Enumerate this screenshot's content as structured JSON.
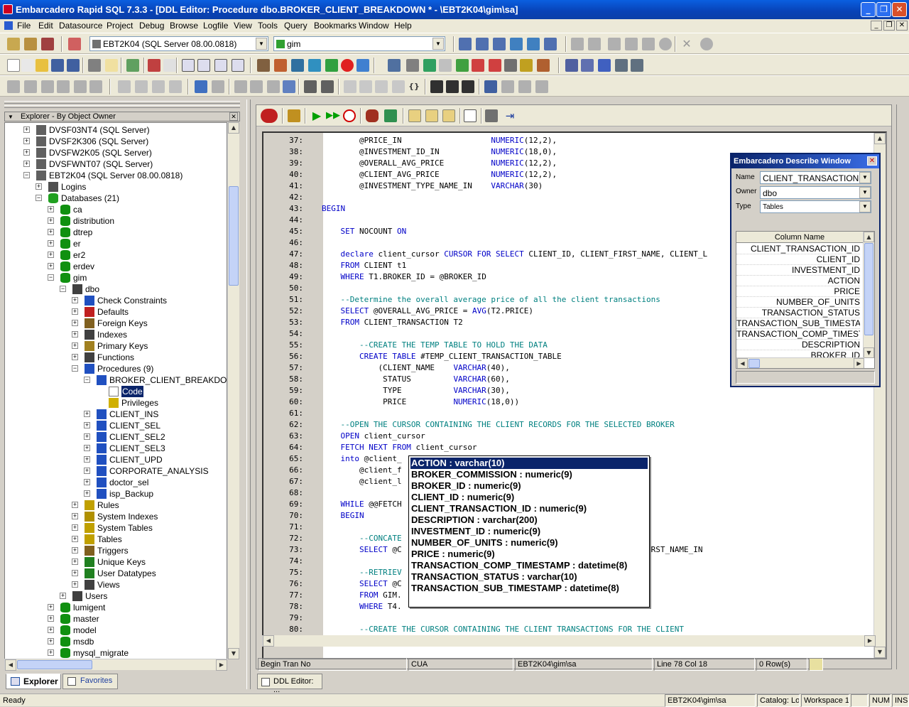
{
  "window": {
    "title": "Embarcadero Rapid SQL 7.3.3 - [DDL Editor: Procedure dbo.BROKER_CLIENT_BREAKDOWN * - \\EBT2K04\\gim\\sa]"
  },
  "menu": [
    "File",
    "Edit",
    "Datasource",
    "Project",
    "Debug",
    "Browse",
    "Logfile",
    "View",
    "Tools",
    "Query",
    "Bookmarks",
    "Window",
    "Help"
  ],
  "toolbar": {
    "datasource_combo": "EBT2K04 (SQL Server 08.00.0818)",
    "database_combo": "gim"
  },
  "explorer": {
    "header": "Explorer - By Object Owner",
    "tree": [
      {
        "label": "DVSF03NT4 (SQL Server)",
        "level": 1,
        "pm": "+",
        "icon": "server-icon"
      },
      {
        "label": "DVSF2K306 (SQL Server)",
        "level": 1,
        "pm": "+",
        "icon": "server-icon"
      },
      {
        "label": "DVSFW2K05 (SQL Server)",
        "level": 1,
        "pm": "+",
        "icon": "server-icon"
      },
      {
        "label": "DVSFWNT07 (SQL Server)",
        "level": 1,
        "pm": "+",
        "icon": "server-icon"
      },
      {
        "label": "EBT2K04 (SQL Server 08.00.0818)",
        "level": 1,
        "pm": "-",
        "icon": "server-icon"
      },
      {
        "label": "Logins",
        "level": 2,
        "pm": "+",
        "icon": "logins-icon"
      },
      {
        "label": "Databases (21)",
        "level": 2,
        "pm": "-",
        "icon": "databases-icon"
      },
      {
        "label": "ca",
        "level": 3,
        "pm": "+",
        "icon": "database-icon"
      },
      {
        "label": "distribution",
        "level": 3,
        "pm": "+",
        "icon": "database-icon"
      },
      {
        "label": "dtrep",
        "level": 3,
        "pm": "+",
        "icon": "database-icon"
      },
      {
        "label": "er",
        "level": 3,
        "pm": "+",
        "icon": "database-icon"
      },
      {
        "label": "er2",
        "level": 3,
        "pm": "+",
        "icon": "database-icon"
      },
      {
        "label": "erdev",
        "level": 3,
        "pm": "+",
        "icon": "database-icon"
      },
      {
        "label": "gim",
        "level": 3,
        "pm": "-",
        "icon": "database-icon"
      },
      {
        "label": "dbo",
        "level": 4,
        "pm": "-",
        "icon": "owner-icon"
      },
      {
        "label": "Check Constraints",
        "level": 5,
        "pm": "+",
        "icon": "check-constraints-icon"
      },
      {
        "label": "Defaults",
        "level": 5,
        "pm": "+",
        "icon": "defaults-icon"
      },
      {
        "label": "Foreign Keys",
        "level": 5,
        "pm": "+",
        "icon": "foreign-keys-icon"
      },
      {
        "label": "Indexes",
        "level": 5,
        "pm": "+",
        "icon": "indexes-icon"
      },
      {
        "label": "Primary Keys",
        "level": 5,
        "pm": "+",
        "icon": "primary-keys-icon"
      },
      {
        "label": "Functions",
        "level": 5,
        "pm": "+",
        "icon": "functions-icon"
      },
      {
        "label": "Procedures (9)",
        "level": 5,
        "pm": "-",
        "icon": "procedures-icon"
      },
      {
        "label": "BROKER_CLIENT_BREAKDOWN",
        "level": 6,
        "pm": "-",
        "icon": "procedure-icon"
      },
      {
        "label": "Code",
        "level": 7,
        "pm": "",
        "icon": "code-icon",
        "selected": true
      },
      {
        "label": "Privileges",
        "level": 7,
        "pm": "",
        "icon": "privileges-icon"
      },
      {
        "label": "CLIENT_INS",
        "level": 6,
        "pm": "+",
        "icon": "procedure-icon"
      },
      {
        "label": "CLIENT_SEL",
        "level": 6,
        "pm": "+",
        "icon": "procedure-icon"
      },
      {
        "label": "CLIENT_SEL2",
        "level": 6,
        "pm": "+",
        "icon": "procedure-icon"
      },
      {
        "label": "CLIENT_SEL3",
        "level": 6,
        "pm": "+",
        "icon": "procedure-icon"
      },
      {
        "label": "CLIENT_UPD",
        "level": 6,
        "pm": "+",
        "icon": "procedure-icon"
      },
      {
        "label": "CORPORATE_ANALYSIS",
        "level": 6,
        "pm": "+",
        "icon": "procedure-icon"
      },
      {
        "label": "doctor_sel",
        "level": 6,
        "pm": "+",
        "icon": "procedure-icon"
      },
      {
        "label": "isp_Backup",
        "level": 6,
        "pm": "+",
        "icon": "procedure-icon"
      },
      {
        "label": "Rules",
        "level": 5,
        "pm": "+",
        "icon": "rules-icon"
      },
      {
        "label": "System Indexes",
        "level": 5,
        "pm": "+",
        "icon": "system-indexes-icon"
      },
      {
        "label": "System Tables",
        "level": 5,
        "pm": "+",
        "icon": "system-tables-icon"
      },
      {
        "label": "Tables",
        "level": 5,
        "pm": "+",
        "icon": "tables-icon"
      },
      {
        "label": "Triggers",
        "level": 5,
        "pm": "+",
        "icon": "triggers-icon"
      },
      {
        "label": "Unique Keys",
        "level": 5,
        "pm": "+",
        "icon": "unique-keys-icon"
      },
      {
        "label": "User Datatypes",
        "level": 5,
        "pm": "+",
        "icon": "user-datatypes-icon"
      },
      {
        "label": "Views",
        "level": 5,
        "pm": "+",
        "icon": "views-icon"
      },
      {
        "label": "Users",
        "level": 4,
        "pm": "+",
        "icon": "users-icon"
      },
      {
        "label": "lumigent",
        "level": 3,
        "pm": "+",
        "icon": "database-icon"
      },
      {
        "label": "master",
        "level": 3,
        "pm": "+",
        "icon": "database-icon"
      },
      {
        "label": "model",
        "level": 3,
        "pm": "+",
        "icon": "database-icon"
      },
      {
        "label": "msdb",
        "level": 3,
        "pm": "+",
        "icon": "database-icon"
      },
      {
        "label": "mysql_migrate",
        "level": 3,
        "pm": "+",
        "icon": "database-icon"
      }
    ],
    "tabs": [
      "Explorer",
      "Favorites"
    ]
  },
  "code_lines": [
    {
      "n": "37:",
      "t": [
        [
          "        @PRICE_IN                   ",
          ""
        ],
        [
          "NUMERIC",
          "dt"
        ],
        [
          "(12,2),",
          ""
        ]
      ]
    },
    {
      "n": "38:",
      "t": [
        [
          "        @INVESTMENT_ID_IN           ",
          ""
        ],
        [
          "NUMERIC",
          "dt"
        ],
        [
          "(18,0),",
          ""
        ]
      ]
    },
    {
      "n": "39:",
      "t": [
        [
          "        @OVERALL_AVG_PRICE          ",
          ""
        ],
        [
          "NUMERIC",
          "dt"
        ],
        [
          "(12,2),",
          ""
        ]
      ]
    },
    {
      "n": "40:",
      "t": [
        [
          "        @CLIENT_AVG_PRICE           ",
          ""
        ],
        [
          "NUMERIC",
          "dt"
        ],
        [
          "(12,2),",
          ""
        ]
      ]
    },
    {
      "n": "41:",
      "t": [
        [
          "        @INVESTMENT_TYPE_NAME_IN    ",
          ""
        ],
        [
          "VARCHAR",
          "dt"
        ],
        [
          "(30)",
          ""
        ]
      ]
    },
    {
      "n": "42:",
      "t": []
    },
    {
      "n": "43:",
      "t": [
        [
          "BEGIN",
          "kw"
        ]
      ]
    },
    {
      "n": "44:",
      "t": []
    },
    {
      "n": "45:",
      "t": [
        [
          "    ",
          ""
        ],
        [
          "SET",
          "kw"
        ],
        [
          " NOCOUNT ",
          ""
        ],
        [
          "ON",
          "kw"
        ]
      ]
    },
    {
      "n": "46:",
      "t": []
    },
    {
      "n": "47:",
      "t": [
        [
          "    ",
          ""
        ],
        [
          "declare",
          "kw"
        ],
        [
          " client_cursor ",
          ""
        ],
        [
          "CURSOR FOR SELECT",
          "kw"
        ],
        [
          " CLIENT_ID, CLIENT_FIRST_NAME, CLIENT_L",
          ""
        ]
      ]
    },
    {
      "n": "48:",
      "t": [
        [
          "    ",
          ""
        ],
        [
          "FROM",
          "kw"
        ],
        [
          " CLIENT t1",
          ""
        ]
      ]
    },
    {
      "n": "49:",
      "t": [
        [
          "    ",
          ""
        ],
        [
          "WHERE",
          "kw"
        ],
        [
          " T1.BROKER_ID = @BROKER_ID",
          ""
        ]
      ]
    },
    {
      "n": "50:",
      "t": []
    },
    {
      "n": "51:",
      "t": [
        [
          "    --Determine the overall average price of all the client transactions",
          "cm"
        ]
      ]
    },
    {
      "n": "52:",
      "t": [
        [
          "    ",
          ""
        ],
        [
          "SELECT",
          "kw"
        ],
        [
          " @OVERALL_AVG_PRICE = ",
          ""
        ],
        [
          "AVG",
          "kw"
        ],
        [
          "(T2.PRICE)",
          ""
        ]
      ]
    },
    {
      "n": "53:",
      "t": [
        [
          "    ",
          ""
        ],
        [
          "FROM",
          "kw"
        ],
        [
          " CLIENT_TRANSACTION T2",
          ""
        ]
      ]
    },
    {
      "n": "54:",
      "t": []
    },
    {
      "n": "55:",
      "t": [
        [
          "        --CREATE THE TEMP TABLE TO HOLD THE DATA",
          "cm"
        ]
      ]
    },
    {
      "n": "56:",
      "t": [
        [
          "        ",
          ""
        ],
        [
          "CREATE TABLE",
          "kw"
        ],
        [
          " #TEMP_CLIENT_TRANSACTION_TABLE",
          ""
        ]
      ]
    },
    {
      "n": "57:",
      "t": [
        [
          "            (CLIENT_NAME    ",
          ""
        ],
        [
          "VARCHAR",
          "dt"
        ],
        [
          "(40),",
          ""
        ]
      ]
    },
    {
      "n": "58:",
      "t": [
        [
          "             STATUS         ",
          ""
        ],
        [
          "VARCHAR",
          "dt"
        ],
        [
          "(60),",
          ""
        ]
      ]
    },
    {
      "n": "59:",
      "t": [
        [
          "             TYPE           ",
          ""
        ],
        [
          "VARCHAR",
          "dt"
        ],
        [
          "(30),",
          ""
        ]
      ]
    },
    {
      "n": "60:",
      "t": [
        [
          "             PRICE          ",
          ""
        ],
        [
          "NUMERIC",
          "dt"
        ],
        [
          "(18,0))",
          ""
        ]
      ]
    },
    {
      "n": "61:",
      "t": []
    },
    {
      "n": "62:",
      "t": [
        [
          "    --OPEN THE CURSOR CONTAINING THE CLIENT RECORDS FOR THE SELECTED BROKER",
          "cm"
        ]
      ]
    },
    {
      "n": "63:",
      "t": [
        [
          "    ",
          ""
        ],
        [
          "OPEN",
          "kw"
        ],
        [
          " client_cursor",
          ""
        ]
      ]
    },
    {
      "n": "64:",
      "t": [
        [
          "    ",
          ""
        ],
        [
          "FETCH NEXT FROM",
          "kw"
        ],
        [
          " client_cursor",
          ""
        ]
      ]
    },
    {
      "n": "65:",
      "t": [
        [
          "    ",
          ""
        ],
        [
          "into",
          "kw"
        ],
        [
          " @client_",
          ""
        ]
      ]
    },
    {
      "n": "66:",
      "t": [
        [
          "        @client_f",
          ""
        ]
      ]
    },
    {
      "n": "67:",
      "t": [
        [
          "        @client_l",
          ""
        ]
      ]
    },
    {
      "n": "68:",
      "t": []
    },
    {
      "n": "69:",
      "t": [
        [
          "    ",
          ""
        ],
        [
          "WHILE",
          "kw"
        ],
        [
          " @@FETCH",
          ""
        ]
      ]
    },
    {
      "n": "70:",
      "t": [
        [
          "    ",
          ""
        ],
        [
          "BEGIN",
          "kw"
        ]
      ]
    },
    {
      "n": "71:",
      "t": []
    },
    {
      "n": "72:",
      "t": [
        [
          "        --CONCATE",
          "cm"
        ]
      ]
    },
    {
      "n": "73:",
      "t": [
        [
          "        ",
          ""
        ],
        [
          "SELECT",
          "kw"
        ],
        [
          " @C                                            CLIENT_FIRST_NAME_IN",
          ""
        ]
      ]
    },
    {
      "n": "74:",
      "t": []
    },
    {
      "n": "75:",
      "t": [
        [
          "        --RETRIEV",
          "cm"
        ]
      ]
    },
    {
      "n": "76:",
      "t": [
        [
          "        ",
          ""
        ],
        [
          "SELECT",
          "kw"
        ],
        [
          " @C",
          ""
        ]
      ]
    },
    {
      "n": "77:",
      "t": [
        [
          "        ",
          ""
        ],
        [
          "FROM",
          "kw"
        ],
        [
          " GIM.",
          ""
        ]
      ]
    },
    {
      "n": "78:",
      "t": [
        [
          "        ",
          ""
        ],
        [
          "WHERE",
          "kw"
        ],
        [
          " T4.",
          ""
        ]
      ]
    },
    {
      "n": "79:",
      "t": []
    },
    {
      "n": "80:",
      "t": [
        [
          "        --CREATE THE CURSOR CONTAINING THE CLIENT TRANSACTIONS FOR THE CLIENT",
          "cm"
        ]
      ]
    }
  ],
  "autocomplete": [
    "ACTION : varchar(10)",
    "BROKER_COMMISSION : numeric(9)",
    "BROKER_ID : numeric(9)",
    "CLIENT_ID : numeric(9)",
    "CLIENT_TRANSACTION_ID : numeric(9)",
    "DESCRIPTION : varchar(200)",
    "INVESTMENT_ID : numeric(9)",
    "NUMBER_OF_UNITS : numeric(9)",
    "PRICE : numeric(9)",
    "TRANSACTION_COMP_TIMESTAMP : datetime(8)",
    "TRANSACTION_STATUS : varchar(10)",
    "TRANSACTION_SUB_TIMESTAMP : datetime(8)"
  ],
  "describe": {
    "title": "Embarcadero Describe Window",
    "name_label": "Name",
    "name_value": "CLIENT_TRANSACTION",
    "owner_label": "Owner",
    "owner_value": "dbo",
    "type_label": "Type",
    "type_value": "Tables",
    "column_header": "Column Name",
    "columns": [
      "CLIENT_TRANSACTION_ID",
      "CLIENT_ID",
      "INVESTMENT_ID",
      "ACTION",
      "PRICE",
      "NUMBER_OF_UNITS",
      "TRANSACTION_STATUS",
      "TRANSACTION_SUB_TIMESTAM",
      "TRANSACTION_COMP_TIMESTA",
      "DESCRIPTION",
      "BROKER_ID"
    ]
  },
  "editor_status": {
    "c1": "Begin Tran No",
    "c2": "CUA",
    "c3": "EBT2K04\\gim\\sa",
    "c4": "Line 78 Col 18",
    "c5": "0 Row(s)"
  },
  "doc_tab": "DDL Editor: ...",
  "statusbar": {
    "left": "Ready",
    "server": "EBT2K04\\gim\\sa",
    "catalog": "Catalog: Lo",
    "workspace": "Workspace 1",
    "num": "NUM",
    "ins": "INS"
  }
}
